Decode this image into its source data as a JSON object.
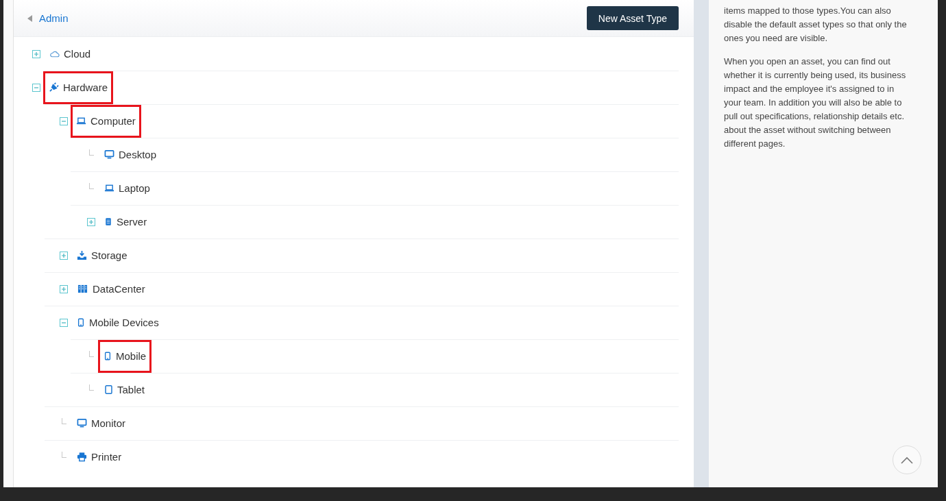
{
  "header": {
    "back_link": "Admin",
    "button": "New Asset Type"
  },
  "tree": [
    {
      "label": "Cloud",
      "kind": "branch",
      "expanded": false,
      "highlighted": false
    },
    {
      "label": "Hardware",
      "kind": "branch",
      "expanded": true,
      "highlighted": true,
      "children": [
        {
          "label": "Computer",
          "kind": "branch",
          "expanded": true,
          "highlighted": true,
          "children": [
            {
              "label": "Desktop",
              "kind": "leaf",
              "highlighted": false
            },
            {
              "label": "Laptop",
              "kind": "leaf",
              "highlighted": false
            },
            {
              "label": "Server",
              "kind": "branch",
              "expanded": false,
              "highlighted": false
            }
          ]
        },
        {
          "label": "Storage",
          "kind": "branch",
          "expanded": false,
          "highlighted": false
        },
        {
          "label": "DataCenter",
          "kind": "branch",
          "expanded": false,
          "highlighted": false
        },
        {
          "label": "Mobile Devices",
          "kind": "branch",
          "expanded": true,
          "highlighted": false,
          "children": [
            {
              "label": "Mobile",
              "kind": "leaf",
              "highlighted": true
            },
            {
              "label": "Tablet",
              "kind": "leaf",
              "highlighted": false
            }
          ]
        },
        {
          "label": "Monitor",
          "kind": "leaf",
          "highlighted": false
        },
        {
          "label": "Printer",
          "kind": "leaf",
          "highlighted": false
        }
      ]
    }
  ],
  "help": {
    "paragraphs": [
      "items mapped to those types.You can also disable the default asset types so that only the ones you need are visible.",
      "When you open an asset, you can find out whether it is currently being used, its business impact and the employee it's assigned to in your team. In addition you will also be able to pull out specifications, relationship details etc. about the asset without switching between different pages."
    ]
  }
}
